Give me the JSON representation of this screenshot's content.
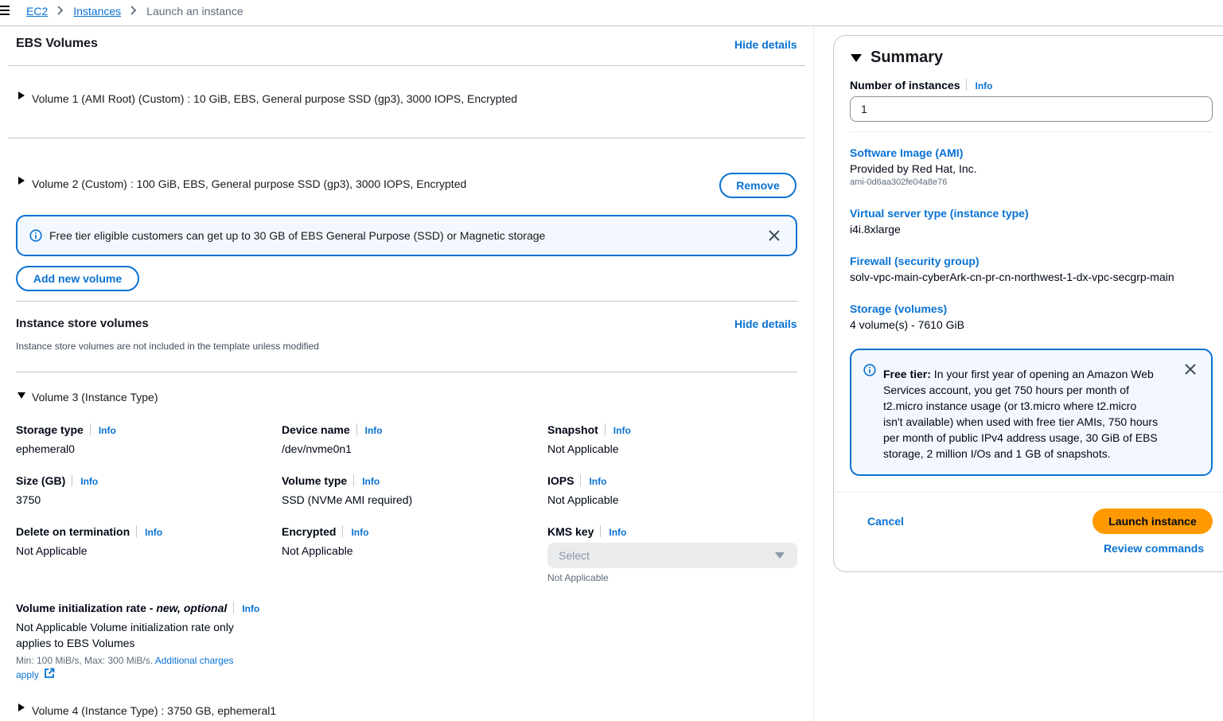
{
  "breadcrumb": {
    "items": [
      "EC2",
      "Instances"
    ],
    "current": "Launch an instance"
  },
  "ebs": {
    "title": "EBS Volumes",
    "hide_details": "Hide details",
    "volume1": "Volume 1 (AMI Root) (Custom) : 10 GiB, EBS, General purpose SSD (gp3), 3000 IOPS, Encrypted",
    "volume2": "Volume 2 (Custom) : 100 GiB, EBS, General purpose SSD (gp3), 3000 IOPS, Encrypted",
    "remove": "Remove",
    "free_tier_alert": "Free tier eligible customers can get up to 30 GB of EBS General Purpose (SSD) or Magnetic storage",
    "add_volume": "Add new volume"
  },
  "instance_store": {
    "title": "Instance store volumes",
    "hide_details": "Hide details",
    "description": "Instance store volumes are not included in the template unless modified",
    "volume3": "Volume 3 (Instance Type)",
    "info": "Info",
    "fields": {
      "storage_type": {
        "label": "Storage type",
        "value": "ephemeral0"
      },
      "device_name": {
        "label": "Device name",
        "value": "/dev/nvme0n1"
      },
      "snapshot": {
        "label": "Snapshot",
        "value": "Not Applicable"
      },
      "size": {
        "label": "Size (GB)",
        "value": "3750"
      },
      "volume_type": {
        "label": "Volume type",
        "value": "SSD (NVMe AMI required)"
      },
      "iops": {
        "label": "IOPS",
        "value": "Not Applicable"
      },
      "delete_on_termination": {
        "label": "Delete on termination",
        "value": "Not Applicable"
      },
      "encrypted": {
        "label": "Encrypted",
        "value": "Not Applicable"
      },
      "kms_key": {
        "label": "KMS key",
        "placeholder": "Select",
        "note": "Not Applicable"
      }
    },
    "init_rate": {
      "label": "Volume initialization rate - ",
      "label_italic": "new, optional",
      "value_line1": "Not Applicable Volume initialization rate only",
      "value_line2": "applies to EBS Volumes",
      "constraint": "Min: 100 MiB/s, Max: 300 MiB/s. ",
      "link_part1": "Additional charges",
      "link_part2": "apply"
    },
    "volume4": "Volume 4 (Instance Type) : 3750 GB, ephemeral1"
  },
  "summary": {
    "title": "Summary",
    "num_instances_label": "Number of instances",
    "info": "Info",
    "num_instances_value": "1",
    "ami_label": "Software Image (AMI)",
    "ami_provider": "Provided by Red Hat, Inc.",
    "ami_id": "ami-0d6aa302fe04a8e76",
    "instance_type_label": "Virtual server type (instance type)",
    "instance_type_value": "i4i.8xlarge",
    "firewall_label": "Firewall (security group)",
    "firewall_value": "solv-vpc-main-cyberArk-cn-pr-cn-northwest-1-dx-vpc-secgrp-main",
    "storage_label": "Storage (volumes)",
    "storage_value": "4 volume(s) - 7610 GiB",
    "free_tier_title": "Free tier:",
    "free_tier_lines": [
      " In your first year of opening an Amazon Web",
      "Services account, you get 750 hours per month of",
      "t2.micro instance usage (or t3.micro where t2.micro",
      "isn't available) when used with free tier AMIs, 750 hours",
      "per month of public IPv4 address usage, 30 GiB of EBS",
      "storage, 2 million I/Os and 1 GB of snapshots."
    ],
    "cancel": "Cancel",
    "launch": "Launch instance",
    "review": "Review commands"
  },
  "colors": {
    "link": "#0972d3",
    "launch_button": "#ff9900",
    "alert_bg": "#f2f8fd",
    "border": "#c6c6cd"
  }
}
